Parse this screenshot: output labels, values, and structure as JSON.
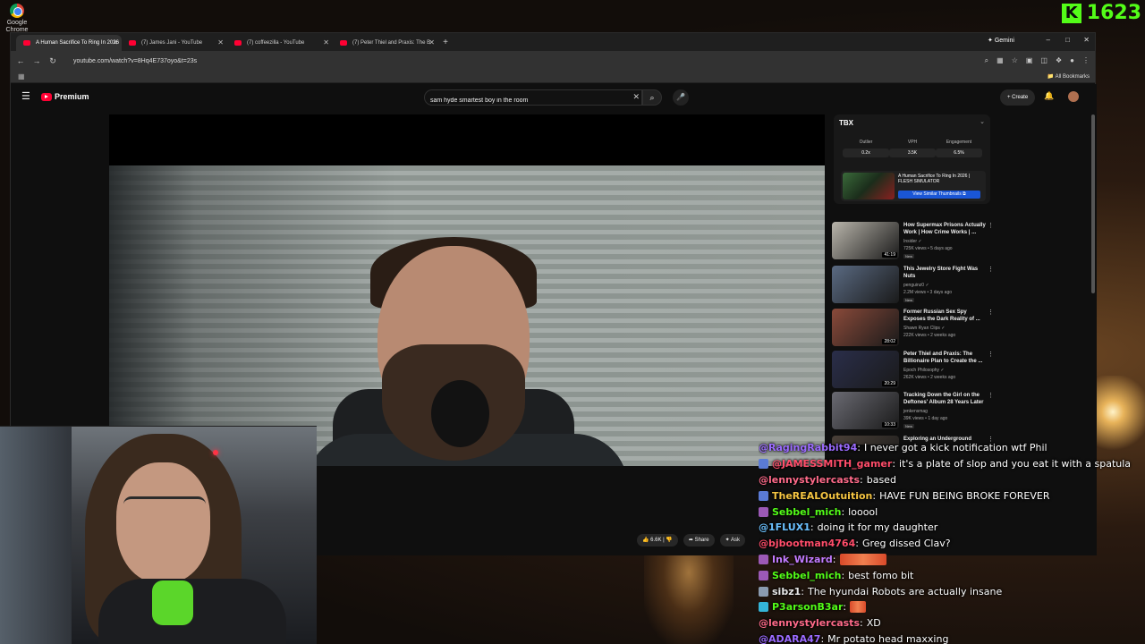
{
  "desktop": {
    "chrome_icon_label": "Google Chrome",
    "kick_count": "1623"
  },
  "browser": {
    "tabs": [
      {
        "label": "A Human Sacrifice To Ring In 2026",
        "active": true
      },
      {
        "label": "(7) James Jani - YouTube",
        "active": false
      },
      {
        "label": "(7) coffeezilla - YouTube",
        "active": false
      },
      {
        "label": "(7) Peter Thiel and Praxis: The B",
        "active": false
      }
    ],
    "new_tab": "+",
    "gemini_label": "Gemini",
    "window_controls": [
      "–",
      "□",
      "✕"
    ],
    "url": "youtube.com/watch?v=8Hq4E737oyo&t=23s",
    "all_bookmarks": "All Bookmarks"
  },
  "youtube": {
    "logo_text": "Premium",
    "search": {
      "value": "sam hyde smartest boy in the room",
      "clear": "✕",
      "button": "⌕",
      "mic": "●"
    },
    "create_label": "+ Create",
    "actions": {
      "likes": "6.6K",
      "share": "Share",
      "ask": "Ask"
    }
  },
  "extension": {
    "logo": "TBX",
    "metrics": [
      {
        "label": "Outlier",
        "value": "0.2x"
      },
      {
        "label": "VPH",
        "value": "3.5K"
      },
      {
        "label": "Engagement",
        "value": "6.5%"
      }
    ],
    "card_title": "A Human Sacrifice To Ring In 2026 | FLESH SIMULATOR",
    "card_button": "View Similar Thumbnails ⧉"
  },
  "recommendations": [
    {
      "title": "How Supermax Prisons Actually Work | How Crime Works | ...",
      "channel": "Insider ✓",
      "meta": "725K views • 5 days ago",
      "badge": "New",
      "duration": "41:19",
      "color": "#b9b5ab"
    },
    {
      "title": "This Jewelry Store Fight Was Nuts",
      "channel": "penguinz0 ✓",
      "meta": "2.2M views • 3 days ago",
      "badge": "New",
      "duration": "",
      "color": "#5a6a82"
    },
    {
      "title": "Former Russian Sex Spy Exposes the Dark Reality of ...",
      "channel": "Shawn Ryan Clips ✓",
      "meta": "222K views • 2 weeks ago",
      "badge": "",
      "duration": "28:02",
      "color": "#8a4a3a"
    },
    {
      "title": "Peter Thiel and Praxis: The Billionaire Plan to Create the ...",
      "channel": "Epoch Philosophy ✓",
      "meta": "262K views • 2 weeks ago",
      "badge": "",
      "duration": "20:29",
      "color": "#2a2e4a"
    },
    {
      "title": "Tracking Down the Girl on the Deftones' Album 28 Years Later",
      "channel": "jenkensmag",
      "meta": "39K views • 1 day ago",
      "badge": "New",
      "duration": "10:33",
      "color": "#6a6a72"
    },
    {
      "title": "Exploring an Underground",
      "channel": "",
      "meta": "",
      "badge": "",
      "duration": "",
      "color": "#4a4038"
    }
  ],
  "chat": [
    {
      "user": "@RagingRabbit94",
      "color": "#9b6bff",
      "badge": "",
      "msg": "I never got a kick notification wtf Phil",
      "emote": false
    },
    {
      "user": "@JAMESSMITH_gamer",
      "color": "#ff4d6a",
      "badge": "#5a7bd6",
      "msg": "it's a plate of slop and you eat it with a spatula",
      "emote": false
    },
    {
      "user": "@lennystylercasts",
      "color": "#ff6b8a",
      "badge": "",
      "msg": "based",
      "emote": false
    },
    {
      "user": "TheREALOutuition",
      "color": "#f5c542",
      "badge": "#5a7bd6",
      "msg": "HAVE FUN BEING BROKE FOREVER",
      "emote": false
    },
    {
      "user": "Sebbel_mich",
      "color": "#53fc18",
      "badge": "#9b59b6",
      "msg": "looool",
      "emote": false
    },
    {
      "user": "@1FLUX1",
      "color": "#6bc1ff",
      "badge": "",
      "msg": "doing it for my daughter",
      "emote": false
    },
    {
      "user": "@bjbootman4764",
      "color": "#ff4d6a",
      "badge": "",
      "msg": "Greg dissed Clav?",
      "emote": false
    },
    {
      "user": "Ink_Wizard",
      "color": "#c17bff",
      "badge": "#9b59b6",
      "msg": "",
      "emote": true
    },
    {
      "user": "Sebbel_mich",
      "color": "#53fc18",
      "badge": "#9b59b6",
      "msg": "best fomo bit",
      "emote": false
    },
    {
      "user": "sibz1",
      "color": "#e8e8e8",
      "badge": "#8a9bb0",
      "msg": "The hyundai Robots are actually insane",
      "emote": false
    },
    {
      "user": "P3arsonB3ar",
      "color": "#53fc18",
      "badge": "#34b4d8",
      "msg": "",
      "emote": true
    },
    {
      "user": "@lennystylercasts",
      "color": "#ff6b8a",
      "badge": "",
      "msg": "XD",
      "emote": false
    },
    {
      "user": "@ADARA47",
      "color": "#9b6bff",
      "badge": "",
      "msg": "Mr potato head maxxing",
      "emote": false
    }
  ]
}
